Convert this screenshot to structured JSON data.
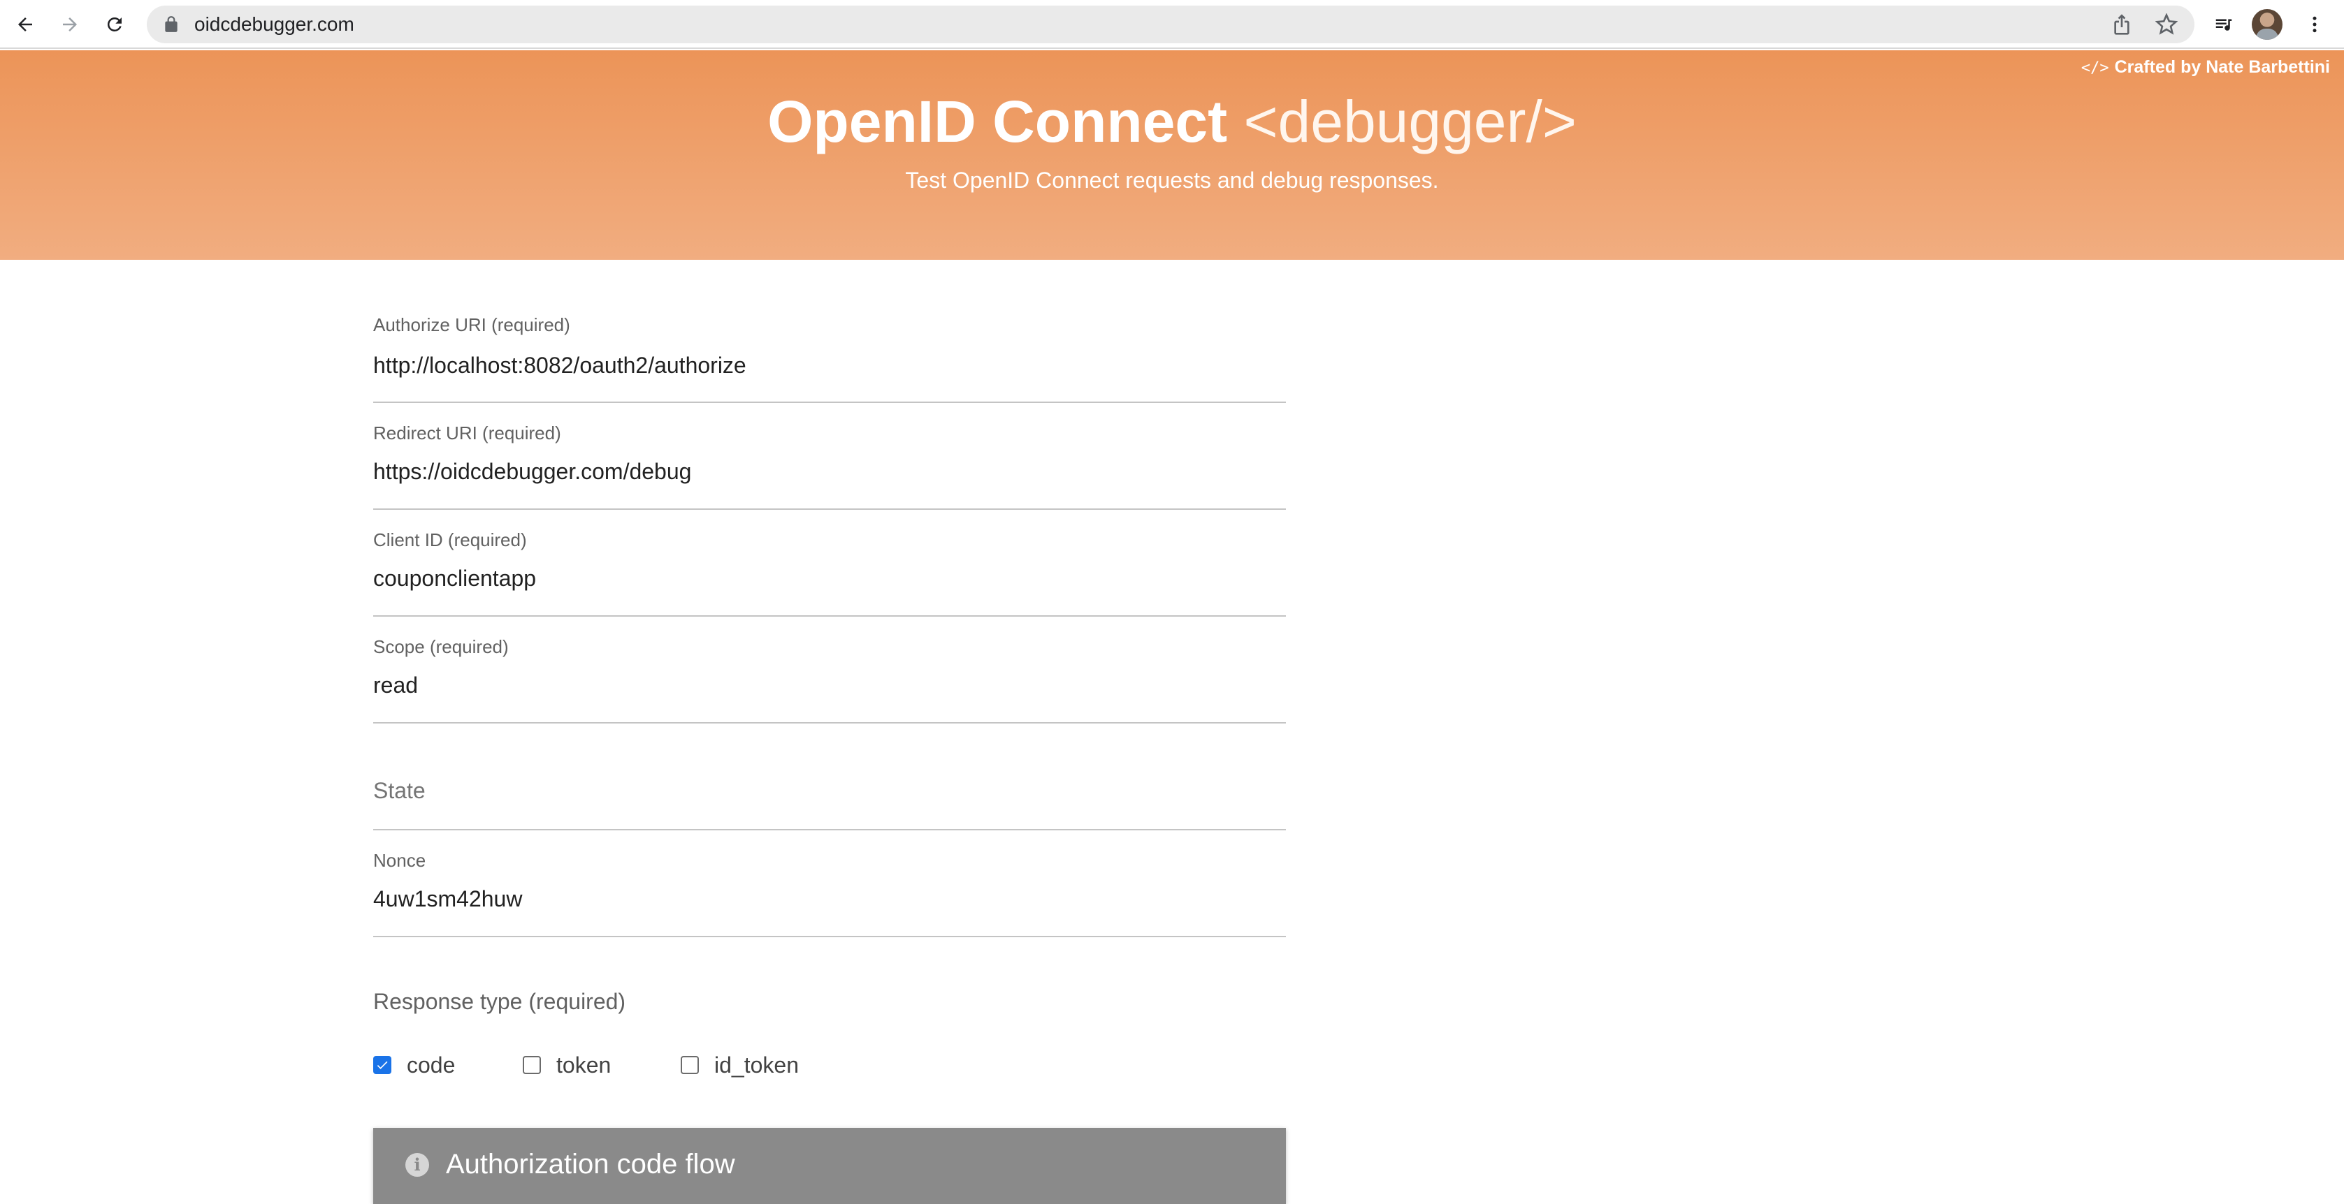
{
  "browser": {
    "url": "oidcdebugger.com"
  },
  "header": {
    "credit": "Crafted by Nate Barbettini",
    "title_brand": "OpenID Connect",
    "title_tag": "<debugger/>",
    "subtitle": "Test OpenID Connect requests and debug responses."
  },
  "form": {
    "authorize_uri": {
      "label": "Authorize URI (required)",
      "value": "http://localhost:8082/oauth2/authorize"
    },
    "redirect_uri": {
      "label": "Redirect URI (required)",
      "value": "https://oidcdebugger.com/debug"
    },
    "client_id": {
      "label": "Client ID (required)",
      "value": "couponclientapp"
    },
    "scope": {
      "label": "Scope (required)",
      "value": "read"
    },
    "state": {
      "placeholder": "State",
      "value": ""
    },
    "nonce": {
      "label": "Nonce",
      "value": "4uw1sm42huw"
    },
    "response_type": {
      "label": "Response type (required)",
      "options": [
        {
          "label": "code",
          "checked": true
        },
        {
          "label": "token",
          "checked": false
        },
        {
          "label": "id_token",
          "checked": false
        }
      ]
    },
    "flow_banner": "Authorization code flow"
  },
  "colors": {
    "header_top": "#ec9458",
    "header_bottom": "#f1ad80",
    "banner": "#8a8a8a",
    "checkbox_checked": "#1a73e8"
  }
}
